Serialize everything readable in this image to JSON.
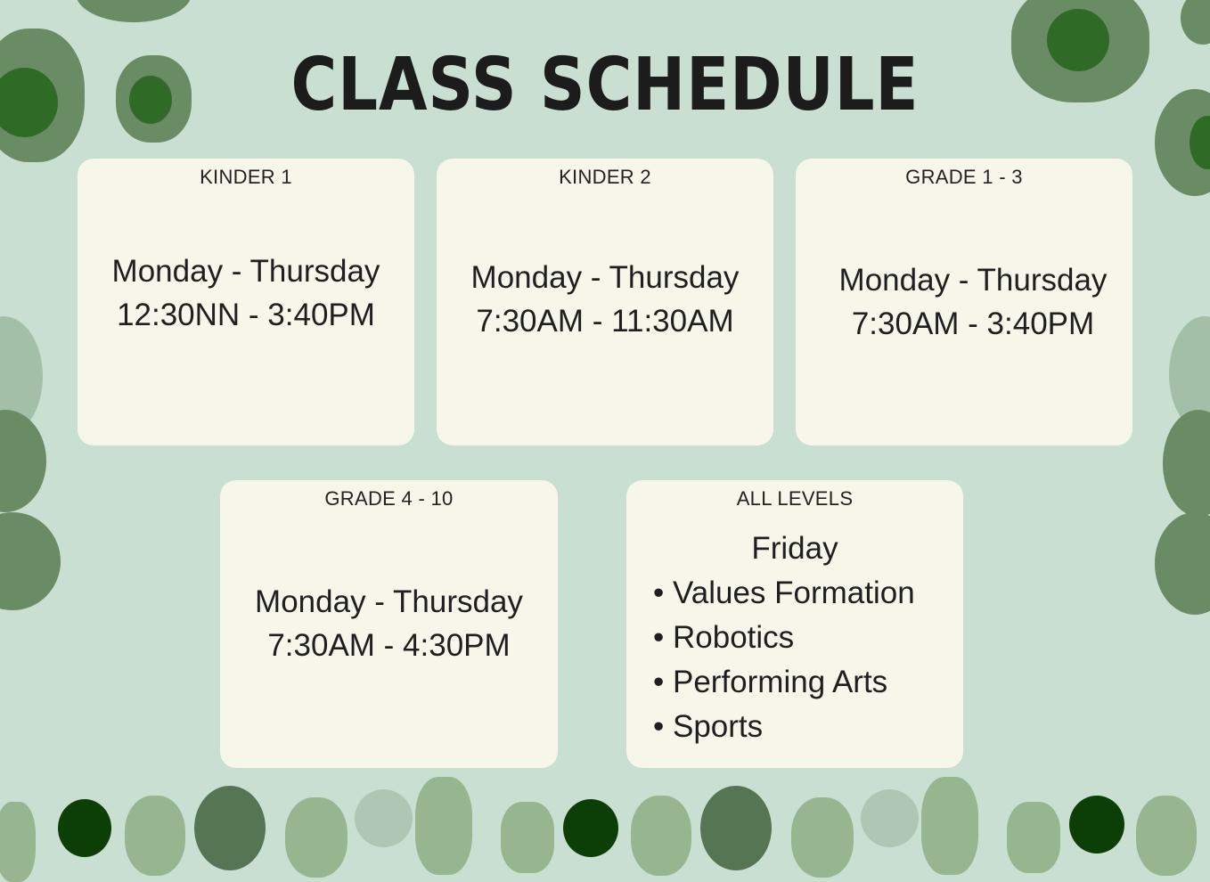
{
  "title": "CLASS SCHEDULE",
  "cards": [
    {
      "heading": "KINDER 1",
      "days": "Monday - Thursday",
      "time": "12:30NN - 3:40PM"
    },
    {
      "heading": "KINDER 2",
      "days": "Monday - Thursday",
      "time": "7:30AM - 11:30AM"
    },
    {
      "heading": "GRADE 1 - 3",
      "days": "Monday - Thursday",
      "time": "7:30AM - 3:40PM"
    },
    {
      "heading": "GRADE 4 - 10",
      "days": "Monday - Thursday",
      "time": "7:30AM - 4:30PM"
    }
  ],
  "all_levels": {
    "heading": "ALL LEVELS",
    "day": "Friday",
    "activities": [
      "Values Formation",
      "Robotics",
      "Performing Arts",
      "Sports"
    ]
  },
  "colors": {
    "background": "#c8dfd2",
    "card": "#f6f7ea",
    "dark_green": "#0b3f06",
    "mid_green": "#5a7a55",
    "light_green": "#97b58f"
  }
}
